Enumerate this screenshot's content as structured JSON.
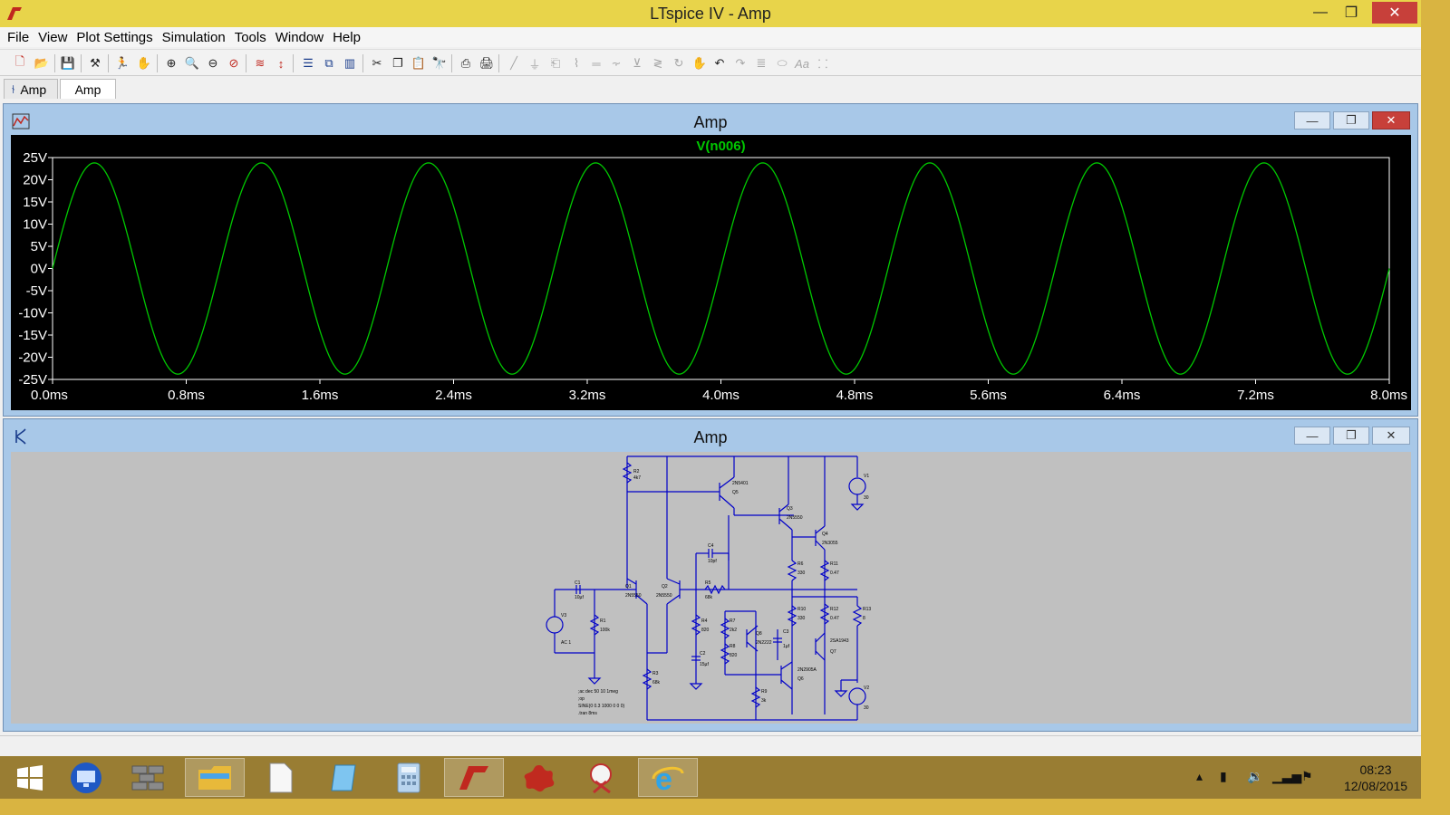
{
  "window": {
    "title": "LTspice IV - Amp"
  },
  "menu": [
    "File",
    "View",
    "Plot Settings",
    "Simulation",
    "Tools",
    "Window",
    "Help"
  ],
  "toolbar": {
    "icons": [
      "new-schematic-icon",
      "open-icon",
      "save-icon",
      "control-panel-icon",
      "run-icon",
      "pan-icon",
      "zoom-in-icon",
      "zoom-area-icon",
      "zoom-out-icon",
      "zoom-fit-icon",
      "autorange-icon",
      "vertical-autorange-icon",
      "tile-horizontal-icon",
      "cascade-icon",
      "tile-vertical-icon",
      "cut-icon",
      "copy-icon",
      "paste-icon",
      "find-icon",
      "print-preview-icon",
      "print-icon",
      "draw-wire-icon",
      "ground-icon",
      "label-net-icon",
      "resistor-icon",
      "capacitor-icon",
      "inductor-icon",
      "diode-icon",
      "component-icon",
      "rotate-icon",
      "hand-icon",
      "undo-icon",
      "redo-icon",
      "text-icon",
      "spice-directive-icon"
    ]
  },
  "tabs": [
    {
      "label": "Amp",
      "icon": "schematic-icon"
    },
    {
      "label": "Amp"
    }
  ],
  "plot_window": {
    "title": "Amp"
  },
  "schematic_window": {
    "title": "Amp",
    "components": {
      "r2": "R2",
      "r2v": "4k7",
      "q5": "2N5401",
      "q5n": "Q5",
      "q3": "Q3",
      "q3v": "2N5550",
      "q4": "Q4",
      "q4v": "2N3055",
      "v1": "V1",
      "v1v": "30",
      "c4": "C4",
      "c4v": "10pf",
      "r5": "R5",
      "r5v": "68k",
      "r6": "R6",
      "r6v": "330",
      "r11": "R11",
      "r11v": "0.47",
      "c1": "C1",
      "c1v": "10µf",
      "q1": "Q1",
      "q1v": "2N5550",
      "q2": "Q2",
      "q2v": "2N5550",
      "r10": "R10",
      "r10v": "330",
      "r12": "R12",
      "r12v": "0.47",
      "r13": "R13",
      "r13v": "8",
      "v3": "V3",
      "v3v": "AC 1",
      "r1": "R1",
      "r1v": "100k",
      "r4": "R4",
      "r4v": "820",
      "r7": "R7",
      "r7v": "2k2",
      "q8": "Q8",
      "q8v": "2N2222",
      "c3": "C3",
      "c3v": "1µf",
      "q7v": "2SA1943",
      "q7": "Q7",
      "r8": "R8",
      "r8v": "820",
      "c2": "C2",
      "c2v": "15µf",
      "q6v": "2N2905A",
      "q6": "Q6",
      "r3": "R3",
      "r3v": "68k",
      "r9": "R9",
      "r9v": "3k",
      "v2": "V2",
      "v2v": "30",
      "directive1": ";ac dec 50 10 1meg",
      "directive2": ";op",
      "directive3": "SINE(0 0.3 1000 0 0 0)",
      "directive4": ".tran 8ms"
    }
  },
  "taskbar": {
    "apps": [
      "start-icon",
      "remote-desktop-icon",
      "firewall-icon",
      "file-explorer-icon",
      "document-icon",
      "notepad-icon",
      "calculator-icon",
      "ltspice-icon",
      "paint-splat-icon",
      "snipping-tool-icon",
      "internet-explorer-icon"
    ],
    "time": "08:23",
    "date": "12/08/2015"
  },
  "chart_data": {
    "type": "line",
    "title": "V(n006)",
    "series": [
      {
        "name": "V(n006)",
        "color": "#00c800",
        "kind": "sine",
        "amplitude": 23.8,
        "offset": 0,
        "frequency_hz": 1000,
        "phase_deg": 0
      }
    ],
    "xlabel": "",
    "ylabel": "",
    "xlim": [
      0,
      8.0
    ],
    "x_unit": "ms",
    "ylim": [
      -25,
      25
    ],
    "xticks": [
      "0.0ms",
      "0.8ms",
      "1.6ms",
      "2.4ms",
      "3.2ms",
      "4.0ms",
      "4.8ms",
      "5.6ms",
      "6.4ms",
      "7.2ms",
      "8.0ms"
    ],
    "yticks": [
      "25V",
      "20V",
      "15V",
      "10V",
      "5V",
      "0V",
      "-5V",
      "-10V",
      "-15V",
      "-20V",
      "-25V"
    ],
    "background": "#000000",
    "grid": false
  }
}
